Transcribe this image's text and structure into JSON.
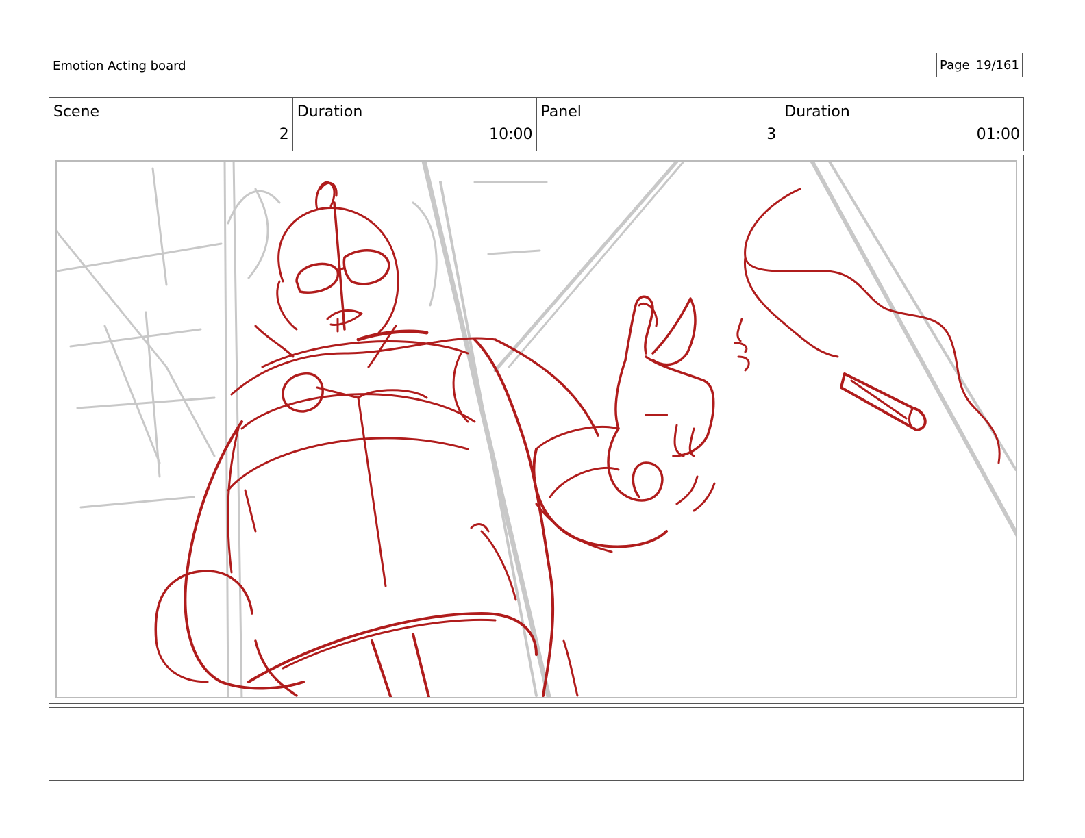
{
  "board": {
    "title": "Emotion Acting board",
    "page_label": "Page",
    "page_value": "19/161"
  },
  "info": {
    "scene_label": "Scene",
    "scene_value": "2",
    "scene_duration_label": "Duration",
    "scene_duration_value": "10:00",
    "panel_label": "Panel",
    "panel_value": "3",
    "panel_duration_label": "Duration",
    "panel_duration_value": "01:00"
  },
  "sketch": {
    "line_color": "#b01c1c",
    "guide_color": "#c8c8c8"
  },
  "notes": {
    "text": ""
  }
}
